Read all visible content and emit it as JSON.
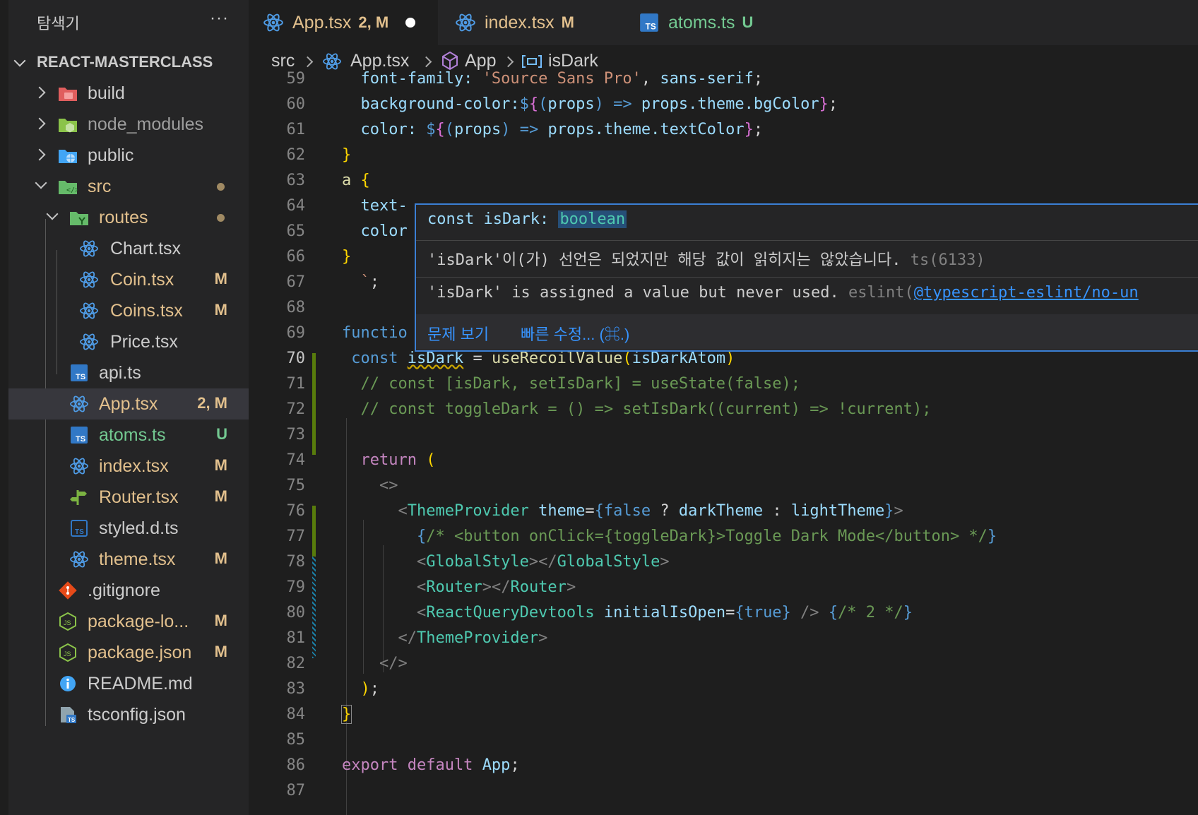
{
  "sidebar": {
    "title": "탐색기",
    "more": "···",
    "root": "REACT-MASTERCLASS",
    "items": [
      {
        "name": "build",
        "badge": "",
        "icon": "folder-build-icon"
      },
      {
        "name": "node_modules",
        "badge": "",
        "icon": "folder-node-icon"
      },
      {
        "name": "public",
        "badge": "",
        "icon": "folder-public-icon"
      },
      {
        "name": "src",
        "badge": "",
        "icon": "folder-src-icon"
      },
      {
        "name": "routes",
        "badge": "",
        "icon": "folder-routes-icon"
      },
      {
        "name": "Chart.tsx",
        "badge": "",
        "icon": "react-icon"
      },
      {
        "name": "Coin.tsx",
        "badge": "M",
        "icon": "react-icon"
      },
      {
        "name": "Coins.tsx",
        "badge": "M",
        "icon": "react-icon"
      },
      {
        "name": "Price.tsx",
        "badge": "",
        "icon": "react-icon"
      },
      {
        "name": "api.ts",
        "badge": "",
        "icon": "typescript-icon"
      },
      {
        "name": "App.tsx",
        "badge": "2, M",
        "icon": "react-icon"
      },
      {
        "name": "atoms.ts",
        "badge": "U",
        "icon": "typescript-icon"
      },
      {
        "name": "index.tsx",
        "badge": "M",
        "icon": "react-icon"
      },
      {
        "name": "Router.tsx",
        "badge": "M",
        "icon": "router-icon"
      },
      {
        "name": "styled.d.ts",
        "badge": "",
        "icon": "typescript-def-icon"
      },
      {
        "name": "theme.tsx",
        "badge": "M",
        "icon": "react-icon"
      },
      {
        "name": ".gitignore",
        "badge": "",
        "icon": "git-icon"
      },
      {
        "name": "package-lo...",
        "badge": "M",
        "icon": "nodejs-icon"
      },
      {
        "name": "package.json",
        "badge": "M",
        "icon": "nodejs-icon"
      },
      {
        "name": "README.md",
        "badge": "",
        "icon": "info-icon"
      },
      {
        "name": "tsconfig.json",
        "badge": "",
        "icon": "tsconfig-icon"
      }
    ]
  },
  "tabs": [
    {
      "name": "App.tsx",
      "badge": "2, M",
      "icon": "react-icon"
    },
    {
      "name": "index.tsx",
      "badge": "M",
      "icon": "react-icon"
    },
    {
      "name": "atoms.ts",
      "badge": "U",
      "icon": "typescript-icon"
    }
  ],
  "breadcrumb": [
    "src",
    "App.tsx",
    "App",
    "isDark"
  ],
  "line_numbers": [
    "59",
    "60",
    "61",
    "62",
    "63",
    "64",
    "65",
    "66",
    "67",
    "68",
    "69",
    "70",
    "71",
    "72",
    "73",
    "74",
    "75",
    "76",
    "77",
    "78",
    "79",
    "80",
    "81",
    "82",
    "83",
    "84",
    "85",
    "86",
    "87"
  ],
  "hover": {
    "signature_prefix": "const isDark: ",
    "signature_type": "boolean",
    "message_ko": "'isDark'이(가) 선언은 되었지만 해당 값이 읽히지는 않았습니다.",
    "code_ko": "ts(6133)",
    "message_en": "'isDark' is assigned a value but never used.",
    "code_en_prefix": "eslint(",
    "code_en_link": "@typescript-eslint/no-un",
    "action_view": "문제 보기",
    "action_fix": "빠른 수정... (⌘.)"
  },
  "colors": {
    "modified": "#e2c08d",
    "untracked": "#73c991",
    "git_added": "#587c0c",
    "accent": "#3b7fd4"
  }
}
